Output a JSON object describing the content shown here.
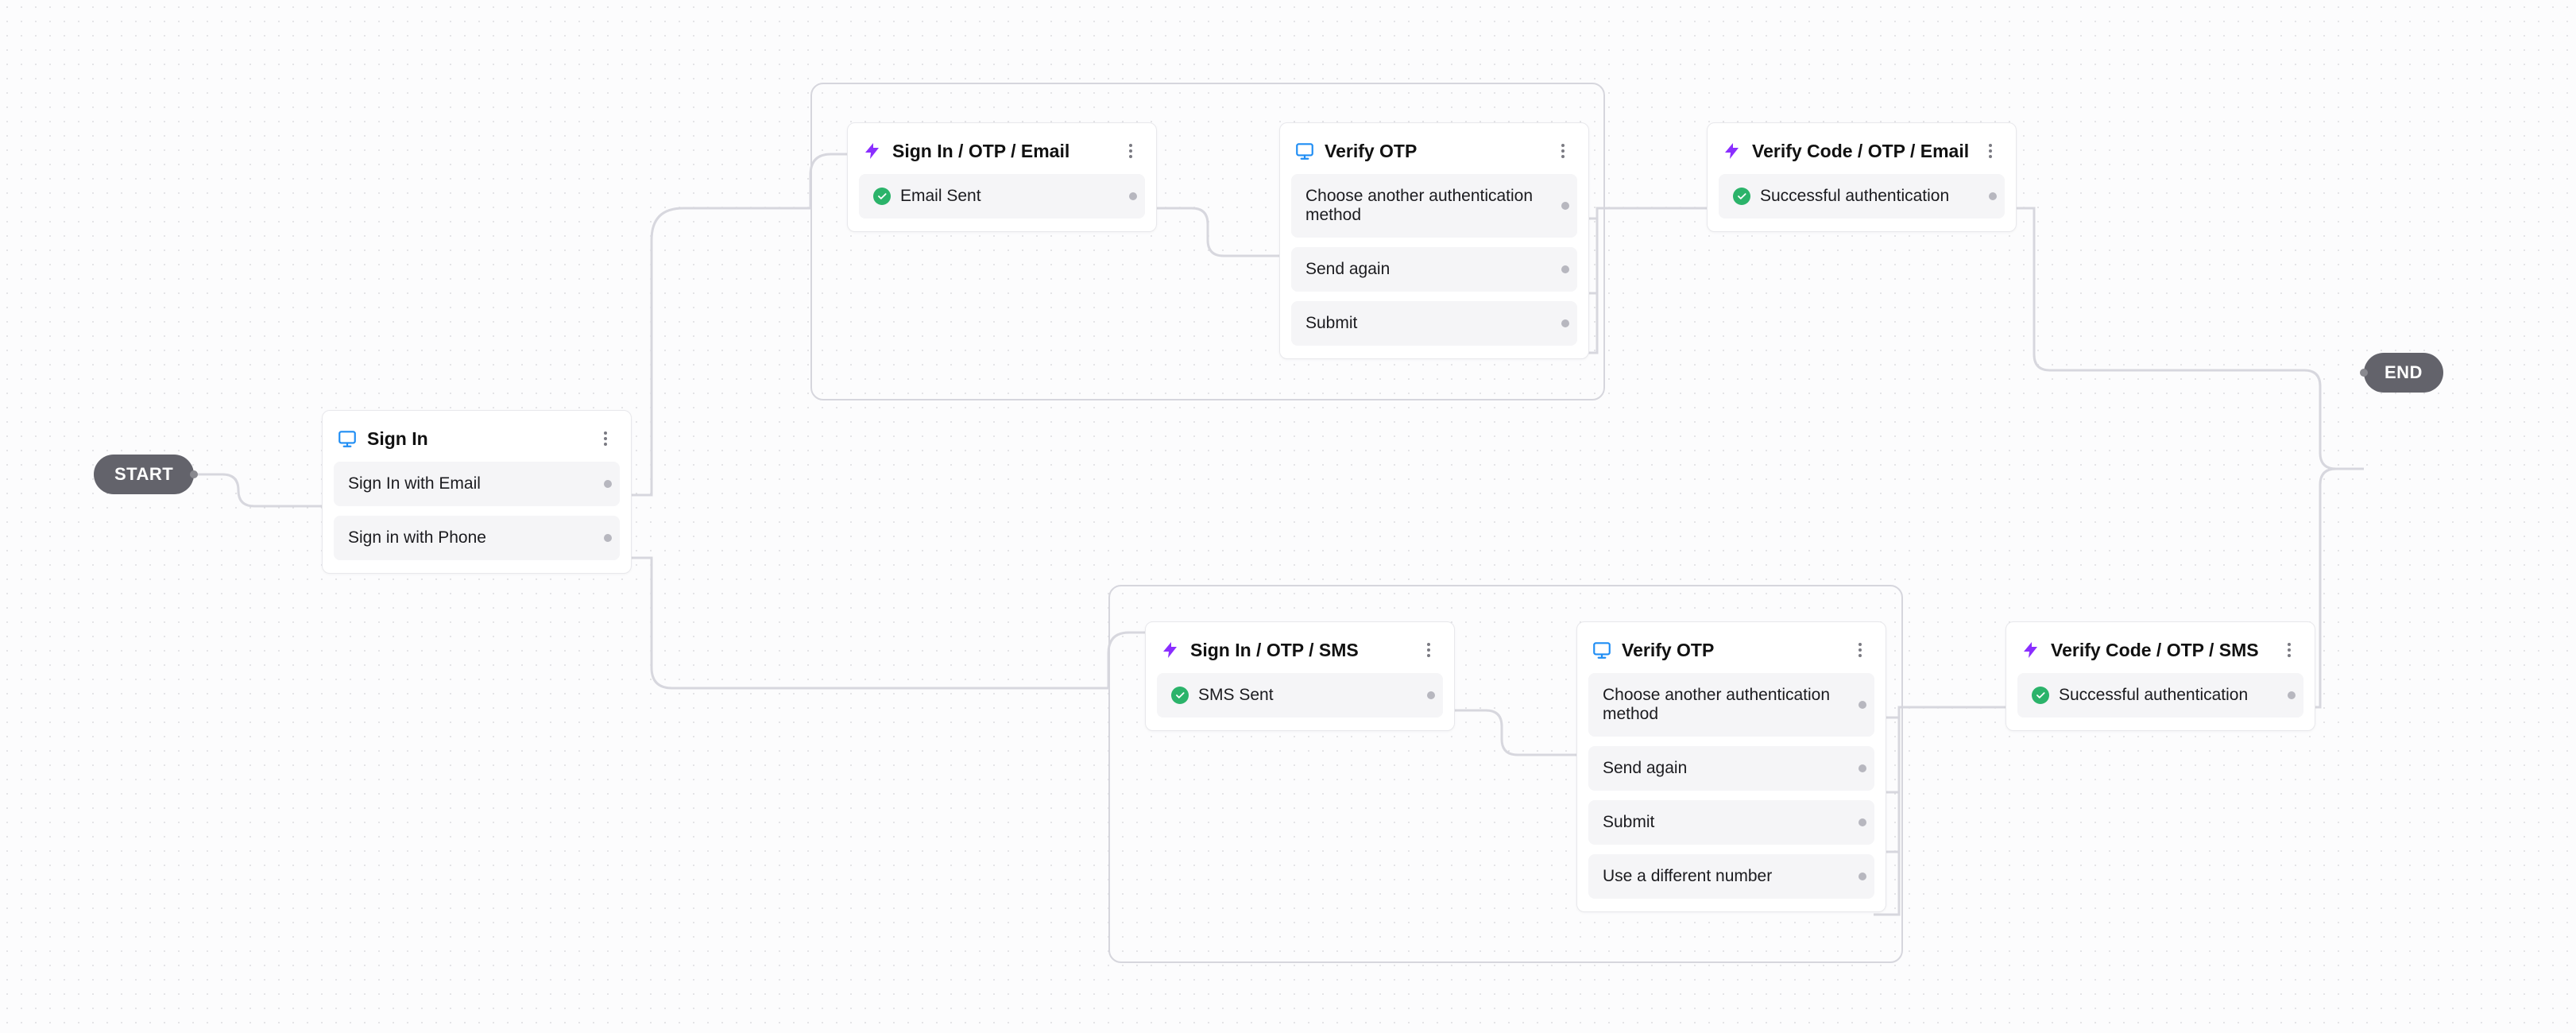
{
  "pills": {
    "start": "START",
    "end": "END"
  },
  "nodes": {
    "signin": {
      "title": "Sign In",
      "icon": "screen",
      "options": [
        {
          "label": "Sign In with Email"
        },
        {
          "label": "Sign in with Phone"
        }
      ]
    },
    "signin_otp_email": {
      "title": "Sign In / OTP / Email",
      "icon": "bolt",
      "options": [
        {
          "label": "Email Sent",
          "status": "success"
        }
      ]
    },
    "verify_otp_email": {
      "title": "Verify OTP",
      "icon": "screen",
      "options": [
        {
          "label": "Choose another authentication method"
        },
        {
          "label": "Send again"
        },
        {
          "label": "Submit"
        }
      ]
    },
    "verify_code_email": {
      "title": "Verify Code / OTP / Email",
      "icon": "bolt",
      "options": [
        {
          "label": "Successful authentication",
          "status": "success"
        }
      ]
    },
    "signin_otp_sms": {
      "title": "Sign In / OTP / SMS",
      "icon": "bolt",
      "options": [
        {
          "label": "SMS Sent",
          "status": "success"
        }
      ]
    },
    "verify_otp_sms": {
      "title": "Verify OTP",
      "icon": "screen",
      "options": [
        {
          "label": "Choose another authentication method"
        },
        {
          "label": "Send again"
        },
        {
          "label": "Submit"
        },
        {
          "label": "Use a different number"
        }
      ]
    },
    "verify_code_sms": {
      "title": "Verify Code / OTP / SMS",
      "icon": "bolt",
      "options": [
        {
          "label": "Successful authentication",
          "status": "success"
        }
      ]
    }
  }
}
